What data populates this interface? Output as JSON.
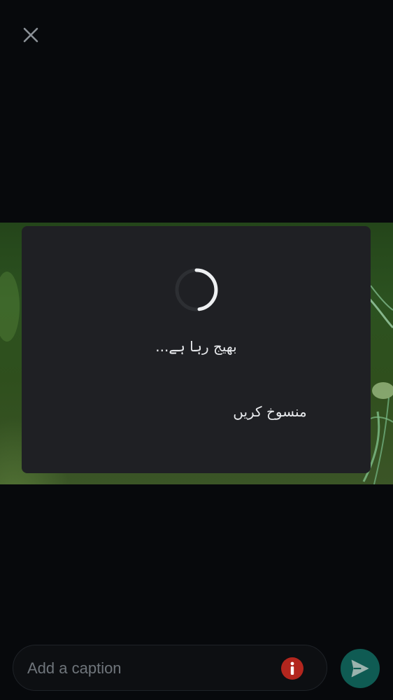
{
  "top_bar": {
    "close_icon": "close-icon"
  },
  "media": {
    "kind": "plant-photo"
  },
  "dialog": {
    "spinner_icon": "loading-spinner-icon",
    "status_text": "بھیج رہا ہے...",
    "cancel_label": "منسوخ کریں"
  },
  "composer": {
    "caption_placeholder": "Add a caption",
    "caption_value": "",
    "info_icon": "info-icon",
    "send_icon": "send-icon"
  },
  "colors": {
    "background": "#07090c",
    "dialog_bg": "#1f2024",
    "accent": "#0f5b53",
    "info_red": "#b3261e",
    "text": "#e8eaed"
  }
}
